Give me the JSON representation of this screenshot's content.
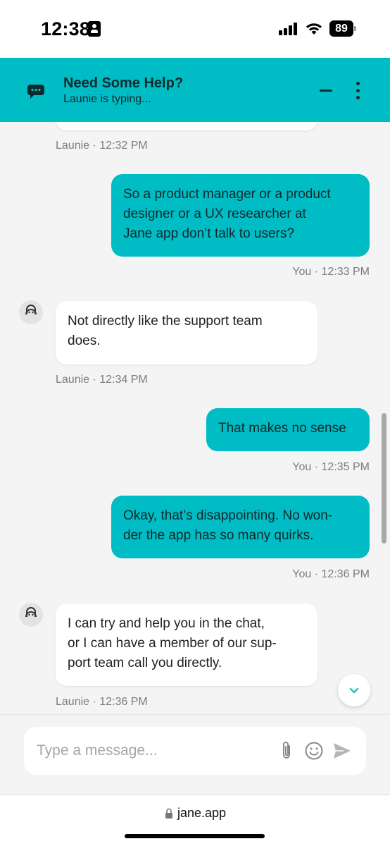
{
  "status_bar": {
    "time": "12:38",
    "battery": "89"
  },
  "header": {
    "title": "Need Some Help?",
    "subtitle": "Launie is typing...",
    "icons": [
      "chat-bubble-icon",
      "minimize-icon",
      "more-vertical-icon"
    ]
  },
  "messages": [
    {
      "sender": "agent",
      "text": "",
      "meta": "Launie · 12:32 PM"
    },
    {
      "sender": "user",
      "lines": [
        "So a product manager or a product",
        "designer or a UX researcher at",
        "Jane app don’t talk to users?"
      ],
      "meta": "You · 12:33 PM"
    },
    {
      "sender": "agent",
      "lines": [
        "Not directly like the support team",
        "does."
      ],
      "meta": "Launie · 12:34 PM"
    },
    {
      "sender": "user",
      "lines": [
        "That makes no sense"
      ],
      "meta": "You · 12:35 PM"
    },
    {
      "sender": "user",
      "lines": [
        "Okay, that’s disappointing. No won-",
        "der the app has so many quirks."
      ],
      "meta": "You · 12:36 PM"
    },
    {
      "sender": "agent",
      "lines": [
        "I can try and help you in the chat,",
        "or I can have a member of our sup-",
        "port team call you directly."
      ],
      "meta": "Launie · 12:36 PM"
    }
  ],
  "composer": {
    "placeholder": "Type a message...",
    "icons": [
      "paperclip-icon",
      "emoji-icon",
      "send-icon"
    ]
  },
  "browser": {
    "url": "jane.app"
  },
  "colors": {
    "accent": "#00bcc5",
    "background": "#f4f4f4",
    "bubble_agent": "#ffffff",
    "meta_text": "#7c7c7c"
  }
}
